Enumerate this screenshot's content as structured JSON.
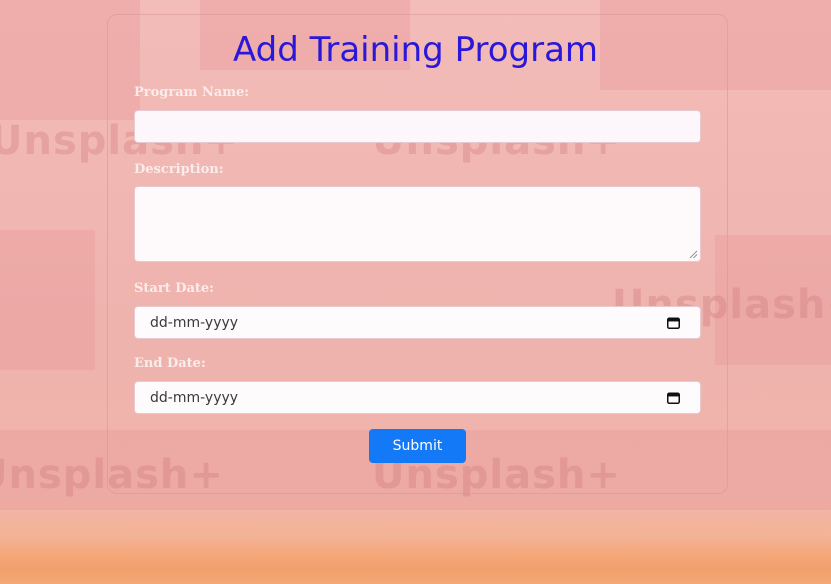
{
  "page": {
    "title": "Add Training Program"
  },
  "form": {
    "program_name": {
      "label": "Program Name:",
      "value": ""
    },
    "description": {
      "label": "Description:",
      "value": ""
    },
    "start_date": {
      "label": "Start Date:",
      "placeholder": "dd-mm-yyyy"
    },
    "end_date": {
      "label": "End Date:",
      "placeholder": "dd-mm-yyyy"
    },
    "submit_label": "Submit"
  },
  "background": {
    "watermark_text": "Unsplash+"
  },
  "colors": {
    "title": "#2a17d9",
    "button": "#1479f7",
    "background": "#f0b6b2"
  },
  "icons": {
    "calendar": "calendar-icon",
    "resize": "resize-grip-icon"
  }
}
